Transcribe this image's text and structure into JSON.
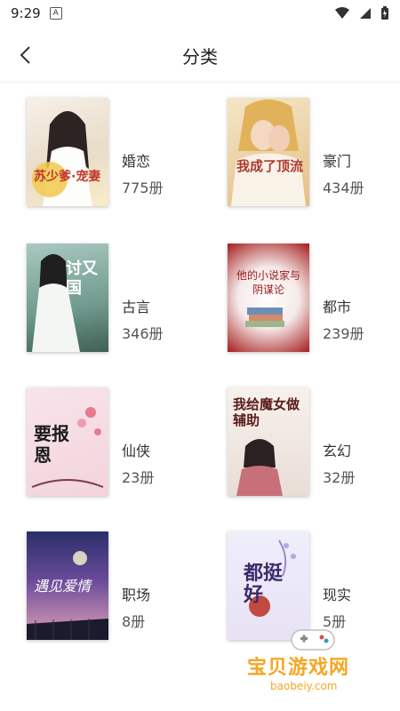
{
  "status": {
    "time": "9:29",
    "notif_badge": "A"
  },
  "header": {
    "title": "分类"
  },
  "categories": [
    {
      "name": "婚恋",
      "count": "775册"
    },
    {
      "name": "豪门",
      "count": "434册"
    },
    {
      "name": "古言",
      "count": "346册"
    },
    {
      "name": "都市",
      "count": "239册"
    },
    {
      "name": "仙侠",
      "count": "23册"
    },
    {
      "name": "玄幻",
      "count": "32册"
    },
    {
      "name": "职场",
      "count": "8册"
    },
    {
      "name": "现实",
      "count": "5册"
    }
  ],
  "covers": [
    {
      "title_text": "苏少爹·宠妻"
    },
    {
      "title_text": "我成了顶流"
    },
    {
      "title_text": "讨又国"
    },
    {
      "title_text": "他的小说家与阴谋论"
    },
    {
      "title_text": "要报恩"
    },
    {
      "title_text": "我给魔女做辅助"
    },
    {
      "title_text": "遇见爱情"
    },
    {
      "title_text": "都挺好"
    }
  ],
  "watermark": {
    "title": "宝贝游戏网",
    "domain": "baobeiy.com"
  },
  "colors": {
    "accent": "#f5a623",
    "divider": "#ececec"
  }
}
